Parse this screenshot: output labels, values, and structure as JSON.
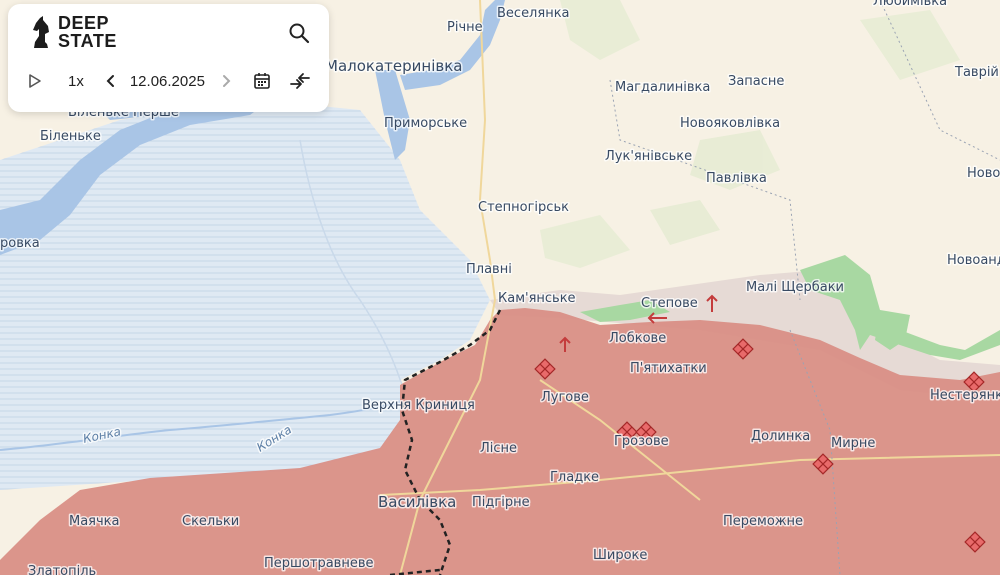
{
  "app": {
    "logo_line1": "DEEP",
    "logo_line2": "STATE"
  },
  "controls": {
    "speed": "1x",
    "date": "12.06.2025",
    "icons": [
      "play-icon",
      "chevron-left-icon",
      "chevron-right-icon",
      "calendar-icon",
      "compare-icon",
      "search-icon"
    ]
  },
  "colors": {
    "occupied": "#d98f86",
    "liberated": "#a8d8a2",
    "gray_zone": "#e3d7d2",
    "water": "#a9c5e6",
    "flooded": "#dce7f1",
    "land": "#f7f1e4",
    "attack": "#c43c3c"
  },
  "map": {
    "places": {
      "veselianka": "Веселянка",
      "richne": "Річне",
      "liubymivka": "Любимівка",
      "malokaterynivka": "Малокатеринівка",
      "bilenke_pershe": "Біленьке Перше",
      "bilenke": "Біленьке",
      "prymorske": "Приморське",
      "mahdalynivka": "Магдалинівка",
      "zapasne": "Запасне",
      "tavriiske": "Таврій",
      "novoiakovlivka": "Новояковлівка",
      "lukianivske": "Лук'янівське",
      "pavlivka": "Павлівка",
      "novo": "Ново",
      "stepnohirsk": "Степногірськ",
      "rovka": "ровка",
      "novoandriivka": "Новоандр",
      "plavni": "Плавні",
      "kamianske": "Кам'янське",
      "stepove": "Степове",
      "mali_shcherbaky": "Малі Щербаки",
      "lobkove": "Лобкове",
      "piatykhatky": "П'ятихатки",
      "luhove": "Лугове",
      "nesterianka": "Нестерянка",
      "verkhnia_krynytsia": "Верхня Криниця",
      "lisne": "Лісне",
      "hroznove": "Грозове",
      "dolynka": "Долинка",
      "myrne": "Мирне",
      "hladke": "Гладке",
      "vasylivka": "Василівка",
      "pidhirne": "Підгірне",
      "maiachka": "Маячка",
      "skelky": "Скельки",
      "peremozhne": "Переможне",
      "pershotravneve": "Першотравневе",
      "shyroke": "Широке",
      "zlatopil": "Златопіль",
      "konka": "Конка"
    }
  }
}
